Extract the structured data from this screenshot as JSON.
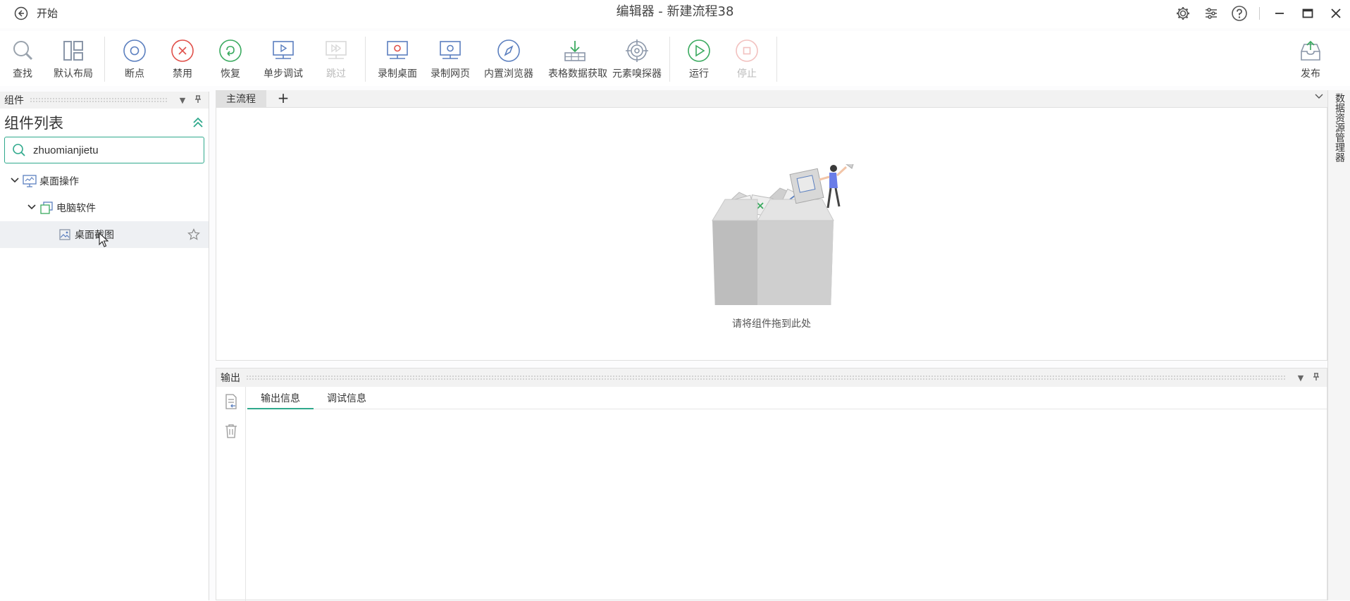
{
  "titlebar": {
    "back_label": "开始",
    "title": "编辑器 - 新建流程38",
    "icons": [
      "settings-icon",
      "plugin-icon",
      "help-icon",
      "minimize-icon",
      "maximize-icon",
      "close-icon"
    ]
  },
  "toolbar": {
    "items": [
      {
        "label": "查找",
        "icon": "search-icon",
        "disabled": false
      },
      {
        "label": "默认布局",
        "icon": "layout-icon",
        "disabled": false
      },
      {
        "label": "断点",
        "icon": "breakpoint-icon",
        "disabled": false
      },
      {
        "label": "禁用",
        "icon": "disable-icon",
        "disabled": false
      },
      {
        "label": "恢复",
        "icon": "restore-icon",
        "disabled": false
      },
      {
        "label": "单步调试",
        "icon": "step-debug-icon",
        "disabled": false
      },
      {
        "label": "跳过",
        "icon": "skip-icon",
        "disabled": true
      },
      {
        "label": "录制桌面",
        "icon": "record-desktop-icon",
        "disabled": false
      },
      {
        "label": "录制网页",
        "icon": "record-web-icon",
        "disabled": false
      },
      {
        "label": "内置浏览器",
        "icon": "browser-icon",
        "disabled": false
      },
      {
        "label": "表格数据获取",
        "icon": "table-data-icon",
        "disabled": false
      },
      {
        "label": "元素嗅探器",
        "icon": "element-sniffer-icon",
        "disabled": false
      },
      {
        "label": "运行",
        "icon": "run-icon",
        "disabled": false
      },
      {
        "label": "停止",
        "icon": "stop-icon",
        "disabled": true
      },
      {
        "label": "发布",
        "icon": "publish-icon",
        "disabled": false
      }
    ]
  },
  "components_panel": {
    "header": "组件",
    "title": "组件列表",
    "search_value": "zhuomianjietu",
    "tree": [
      {
        "label": "桌面操作",
        "icon": "desktop-icon"
      },
      {
        "label": "电脑软件",
        "icon": "software-icon"
      },
      {
        "label": "桌面截图",
        "icon": "screenshot-icon"
      }
    ]
  },
  "editor": {
    "tab_label": "主流程",
    "add_tab": "+",
    "empty_hint": "请将组件拖到此处"
  },
  "right_strip": {
    "label": "数据资源管理器"
  },
  "output_panel": {
    "header": "输出",
    "tabs": [
      "输出信息",
      "调试信息"
    ],
    "active_tab": 0
  },
  "colors": {
    "accent": "#2fa98c",
    "icon_blue": "#5b7fbf",
    "icon_red": "#e0504a",
    "icon_green": "#3aaa5f"
  }
}
